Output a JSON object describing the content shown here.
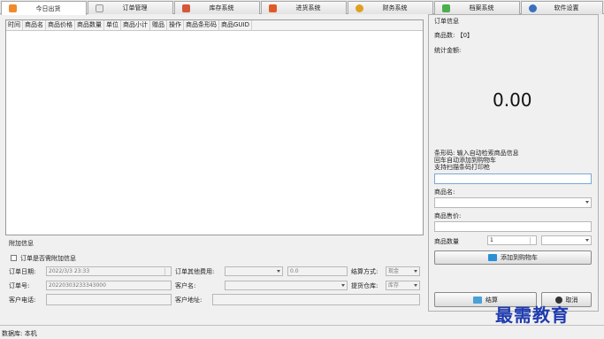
{
  "tabs": [
    {
      "label": "今日出货",
      "icon": "orange-box-icon"
    },
    {
      "label": "订单管理",
      "icon": "order-doc-icon"
    },
    {
      "label": "库存系统",
      "icon": "inventory-icon"
    },
    {
      "label": "进货系统",
      "icon": "fire-bottle-icon"
    },
    {
      "label": "财务系统",
      "icon": "magnifier-icon"
    },
    {
      "label": "档案系统",
      "icon": "archive-icon"
    },
    {
      "label": "软件设置",
      "icon": "gear-icon"
    }
  ],
  "grid": {
    "columns": [
      "时间",
      "商品名",
      "商品价格",
      "商品数量",
      "单位",
      "商品小计",
      "赠品",
      "操作",
      "商品条形码",
      "商品GUID"
    ]
  },
  "extra": {
    "section_title": "附加信息",
    "checkbox_label": "订单是否需附加信息",
    "order_date_label": "订单日期:",
    "order_date_value": "2022/3/3 23:33",
    "order_other_fee_label": "订单其他费用:",
    "order_other_fee_value": "0.0",
    "settle_method_label": "结算方式:",
    "settle_method_value": "现金",
    "order_no_label": "订单号:",
    "order_no_value": "20220303233343000",
    "customer_name_label": "客户名:",
    "pickup_label": "提货仓库:",
    "pickup_value": "库存",
    "customer_phone_label": "客户电话:",
    "customer_address_label": "客户地址:"
  },
  "order_info": {
    "title": "订单信息",
    "product_count": "商品数: 【0】",
    "total_label": "统计金额:",
    "total_value": "0.00",
    "barcode_hint": [
      "条形码: 输入自动检索商品信息",
      "回车自动添加到购物车",
      "支持扫描条码打印枪"
    ],
    "product_name_label": "商品名:",
    "product_price_label": "商品售价:",
    "product_qty_label": "商品数量",
    "product_qty_value": "1",
    "add_cart_label": "添加到购物车",
    "settle_label": "结算",
    "cancel_label": "取消"
  },
  "status": {
    "text": "数据库: 本机"
  },
  "watermark": "最需教育",
  "colors": {
    "accent_blue": "#1f3bb0",
    "add_cart_icon": "#2a8fd6",
    "settle_icon": "#4aa0d8",
    "cancel_icon": "#333333"
  }
}
